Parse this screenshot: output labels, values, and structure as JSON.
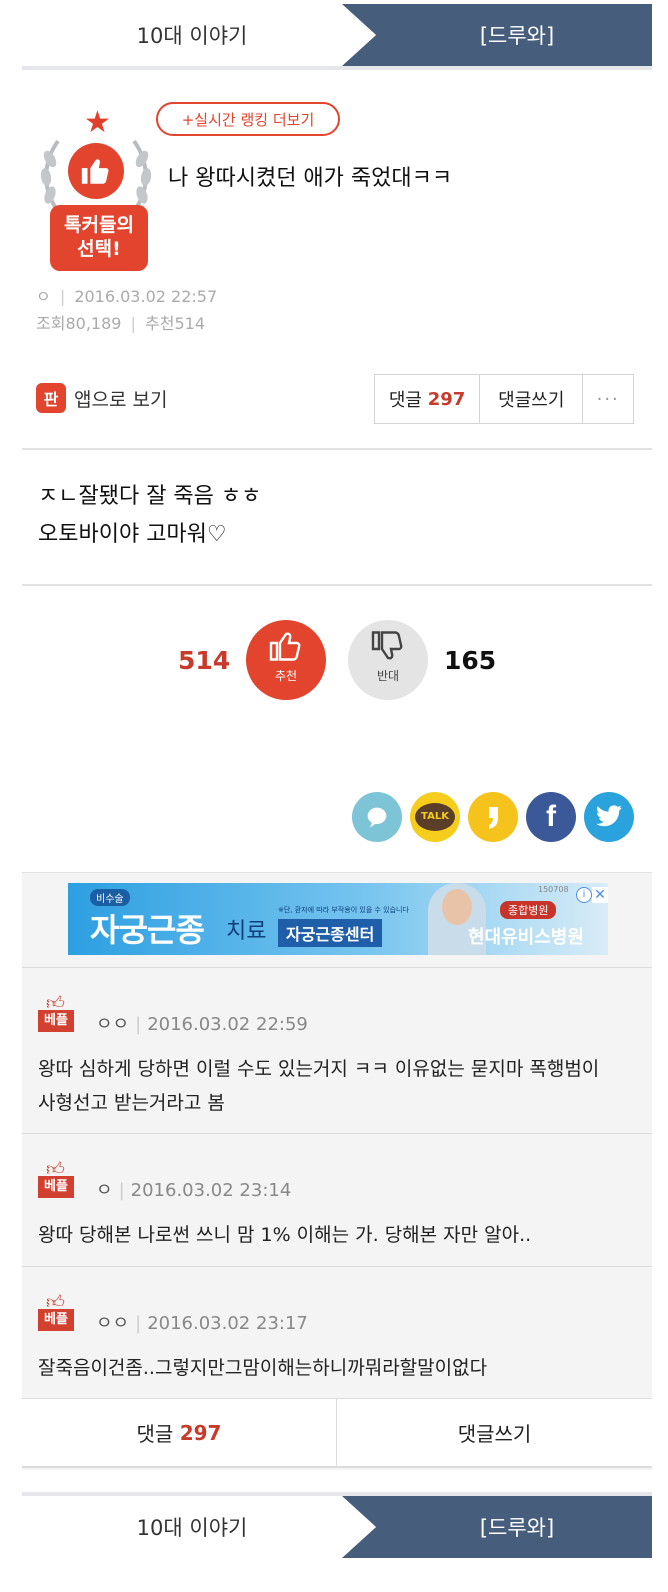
{
  "top_tabs": {
    "left": "10대 이야기",
    "right": "[드루와]"
  },
  "badge": {
    "line1": "톡커들의",
    "line2": "선택!"
  },
  "ranking_button": "+실시간 랭킹 더보기",
  "post": {
    "title": "나 왕따시켰던 애가 죽었대ㅋㅋ",
    "author": "ㅇ",
    "date": "2016.03.02 22:57",
    "views_label": "조회",
    "views": "80,189",
    "recommend_label": "추천",
    "recommend": "514",
    "body_line1": "ㅈㄴ잘됐다 잘 죽음 ㅎㅎ",
    "body_line2": "오토바이야 고마워♡"
  },
  "app_view": {
    "icon": "판",
    "label": "앱으로 보기"
  },
  "actions": {
    "comments_label": "댓글",
    "comments_count": "297",
    "write": "댓글쓰기",
    "more": "···"
  },
  "votes": {
    "up_count": "514",
    "up_label": "추천",
    "down_label": "반대",
    "down_count": "165"
  },
  "share_icons": [
    "comment-bubble-icon",
    "kakaotalk-icon",
    "kakaostory-icon",
    "facebook-icon",
    "twitter-icon"
  ],
  "share": {
    "talk": "TALK",
    "facebook": "f"
  },
  "ad": {
    "tag": "비수술",
    "title": "자궁근종",
    "sub": "치료",
    "note": "※단, 환자에 따라 부작용이 있을 수 있습니다",
    "center": "자궁근종센터",
    "hospital_tag": "종합병원",
    "hospital": "현대유비스병원",
    "number": "150708",
    "info": "i",
    "close": "✕"
  },
  "comments": [
    {
      "badge": "베플",
      "author": "ㅇㅇ",
      "date": "2016.03.02 22:59",
      "line1": "왕따 심하게 당하면 이럴 수도 있는거지 ㅋㅋ 이유없는 묻지마 폭행범이",
      "line2": "사형선고 받는거라고 봄"
    },
    {
      "badge": "베플",
      "author": "ㅇ",
      "date": "2016.03.02 23:14",
      "line1": "왕따 당해본 나로썬 쓰니 맘 1% 이해는 가. 당해본 자만 알아..",
      "line2": ""
    },
    {
      "badge": "베플",
      "author": "ㅇㅇ",
      "date": "2016.03.02 23:17",
      "line1": "잘죽음이건좀..그렇지만그맘이해는하니까뭐라할말이없다",
      "line2": ""
    }
  ],
  "bottom_actions": {
    "comments_label": "댓글",
    "comments_count": "297",
    "write": "댓글쓰기"
  },
  "bottom_tabs": {
    "left": "10대 이야기",
    "right": "[드루와]"
  },
  "colors": {
    "accent": "#e2442d",
    "tab_blue": "#475d7c",
    "count_red": "#c83a2a"
  }
}
